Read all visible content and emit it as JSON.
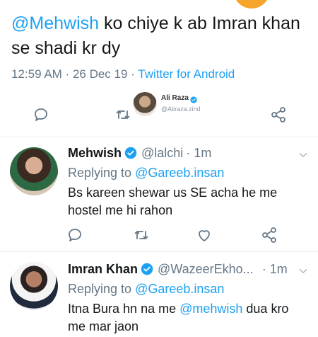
{
  "main_tweet": {
    "mention": "@Mehwish",
    "text_rest": " ko chiye k ab Imran khan se shadi kr dy",
    "time": "12:59 AM",
    "date": "26 Dec 19",
    "separator": " · ",
    "source": "Twitter for Android",
    "actions": [
      "reply-icon",
      "retweet-icon",
      "share-icon"
    ],
    "overlay": {
      "name": "Ali Raza",
      "handle": "@Aliraza.zind"
    }
  },
  "replies": [
    {
      "name": "Mehwish",
      "handle": "@lalchi",
      "time": "· 1m",
      "replying_label": "Replying to",
      "replying_to": "@Gareeb.insan",
      "text": "Bs kareen shewar us SE acha he me hostel me hi rahon",
      "actions": [
        "reply-icon",
        "retweet-icon",
        "like-icon",
        "share-icon"
      ]
    },
    {
      "name": "Imran Khan",
      "handle": "@WazeerEkho...",
      "time": "· 1m",
      "replying_label": "Replying to",
      "replying_to": "@Gareeb.insan",
      "text_before": "Itna Bura hn na me ",
      "mention": "@mehwish",
      "text_after": " dua kro me mar jaon"
    }
  ],
  "colors": {
    "accent": "#1da1f2",
    "secondary_text": "#657786",
    "primary_text": "#14171a",
    "icon": "#657786",
    "divider": "#e6ecf0"
  }
}
